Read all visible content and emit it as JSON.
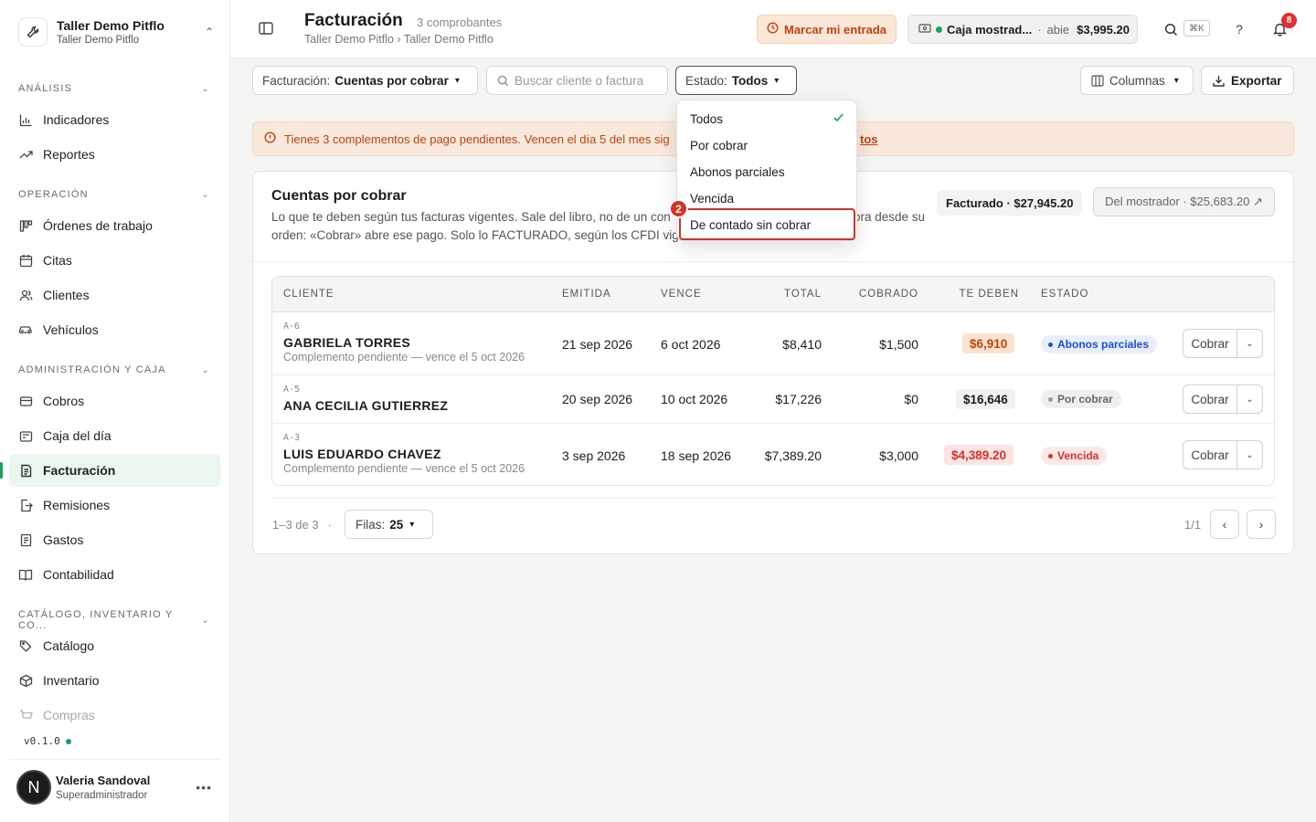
{
  "workspace": {
    "name": "Taller Demo Pitflo",
    "subtitle": "Taller Demo Pitflo"
  },
  "sidebar": {
    "sections": [
      {
        "title": "ANÁLISIS",
        "items": [
          {
            "label": "Indicadores",
            "icon": "bar-chart-icon"
          },
          {
            "label": "Reportes",
            "icon": "trending-up-icon"
          }
        ]
      },
      {
        "title": "OPERACIÓN",
        "items": [
          {
            "label": "Órdenes de trabajo",
            "icon": "kanban-icon"
          },
          {
            "label": "Citas",
            "icon": "calendar-icon"
          },
          {
            "label": "Clientes",
            "icon": "users-icon"
          },
          {
            "label": "Vehículos",
            "icon": "car-icon"
          }
        ]
      },
      {
        "title": "ADMINISTRACIÓN Y CAJA",
        "items": [
          {
            "label": "Cobros",
            "icon": "credit-card-icon"
          },
          {
            "label": "Caja del día",
            "icon": "cash-register-icon"
          },
          {
            "label": "Facturación",
            "icon": "invoice-icon"
          },
          {
            "label": "Remisiones",
            "icon": "file-export-icon"
          },
          {
            "label": "Gastos",
            "icon": "receipt-icon"
          },
          {
            "label": "Contabilidad",
            "icon": "book-open-icon"
          }
        ]
      },
      {
        "title": "CATÁLOGO, INVENTARIO Y CO...",
        "items": [
          {
            "label": "Catálogo",
            "icon": "tags-icon"
          },
          {
            "label": "Inventario",
            "icon": "box-icon"
          },
          {
            "label": "Compras",
            "icon": "cart-icon"
          }
        ]
      }
    ],
    "active": "Facturación",
    "version": "v0.1.0",
    "user": {
      "initial": "N",
      "name": "Valeria Sandoval",
      "role": "Superadministrador"
    }
  },
  "header": {
    "title": "Facturación",
    "count": "3 comprobantes",
    "breadcrumb": "Taller Demo Pitflo › Taller Demo Pitflo",
    "entrada": "Marcar mi entrada",
    "caja": {
      "name": "Caja mostrad...",
      "sep": "·",
      "status": "abie",
      "amount": "$3,995.20"
    },
    "shortcut": "⌘K",
    "help": "?",
    "notifications": "8"
  },
  "filters": {
    "facturacion_label": "Facturación:",
    "facturacion_value": "Cuentas por cobrar",
    "search_placeholder": "Buscar cliente o factura",
    "estado_label": "Estado:",
    "estado_value": "Todos",
    "columnas": "Columnas",
    "exportar": "Exportar"
  },
  "alert": {
    "text": "Tienes 3 complementos de pago pendientes. Vencen el día 5 del mes sig",
    "link": "tos"
  },
  "card": {
    "title": "Cuentas por cobrar",
    "desc1": "Lo que te deben según tus facturas vigentes. Sale del libro, no de un con",
    "desc1b": "ora desde su",
    "desc2": "orden: «Cobrar» abre ese pago. Solo lo FACTURADO, según los CFDI vige",
    "facturado": "Facturado · $27,945.20",
    "mostrador": "Del mostrador · $25,683.20 ↗"
  },
  "table": {
    "headers": [
      "CLIENTE",
      "EMITIDA",
      "VENCE",
      "TOTAL",
      "COBRADO",
      "TE DEBEN",
      "ESTADO"
    ],
    "cobrar_label": "Cobrar",
    "rows": [
      {
        "folio": "A-6",
        "client": "GABRIELA TORRES",
        "note": "Complemento pendiente — vence el 5 oct 2026",
        "emitida": "21 sep 2026",
        "vence": "6 oct 2026",
        "total": "$8,410",
        "cobrado": "$1,500",
        "debe": "$6,910",
        "estado": "Abonos parciales"
      },
      {
        "folio": "A-5",
        "client": "ANA CECILIA GUTIERREZ",
        "note": "",
        "emitida": "20 sep 2026",
        "vence": "10 oct 2026",
        "total": "$17,226",
        "cobrado": "$0",
        "debe": "$16,646",
        "estado": "Por cobrar"
      },
      {
        "folio": "A-3",
        "client": "LUIS EDUARDO CHAVEZ",
        "note": "Complemento pendiente — vence el 5 oct 2026",
        "emitida": "3 sep 2026",
        "vence": "18 sep 2026",
        "total": "$7,389.20",
        "cobrado": "$3,000",
        "debe": "$4,389.20",
        "estado": "Vencida"
      }
    ]
  },
  "pagination": {
    "info": "1–3 de 3",
    "sep": "·",
    "filas_label": "Filas:",
    "filas_value": "25",
    "page": "1/1"
  },
  "dropdown": {
    "options": [
      "Todos",
      "Por cobrar",
      "Abonos parciales",
      "Vencida",
      "De contado sin cobrar"
    ],
    "selected": "Todos",
    "highlight_step": "2"
  },
  "colors": {
    "accent_green": "#1e9e5b",
    "warning_orange": "#c2410c",
    "danger_red": "#d93025",
    "info_blue": "#1d4ed8"
  }
}
